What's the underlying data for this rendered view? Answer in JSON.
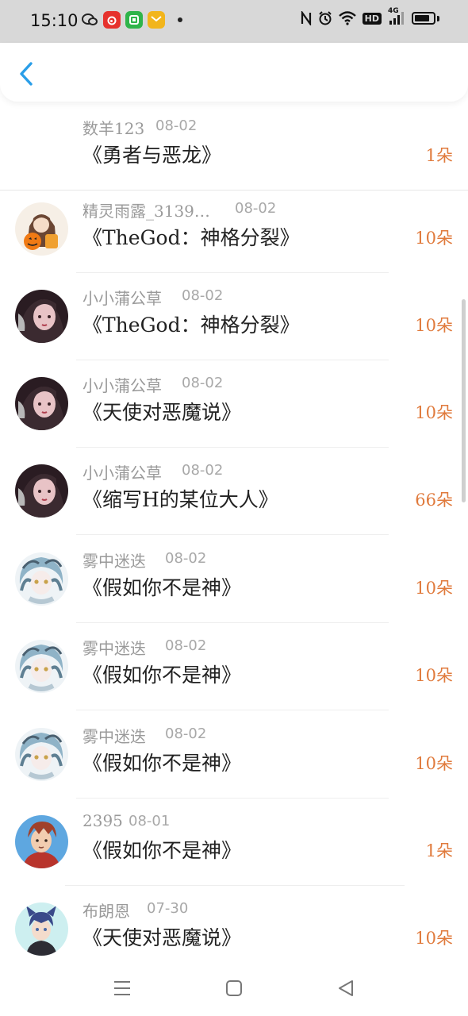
{
  "status_bar": {
    "time": "15:10",
    "left_icons": [
      "wechat-icon",
      "weibo-icon",
      "phone-manager-icon",
      "mail-icon"
    ],
    "right_icons": [
      "nfc-icon",
      "alarm-icon",
      "wifi-icon",
      "hd-icon",
      "signal-4g-icon",
      "battery-icon"
    ],
    "hd_label": "HD",
    "network_label": "4G"
  },
  "header": {
    "back_icon": "chevron-left-icon",
    "accent_color": "#2a9ee8"
  },
  "list": {
    "count_color": "#e07a3c",
    "items": [
      {
        "name": "数羊123",
        "date": "08-02",
        "title": "《勇者与恶龙》",
        "count": "1朵",
        "avatar": "none"
      },
      {
        "name": "精灵雨露_3139…",
        "date": "08-02",
        "title": "《TheGod：神格分裂》",
        "count": "10朵",
        "avatar": "girl-pumpkin"
      },
      {
        "name": "小小蒲公草",
        "date": "08-02",
        "title": "《TheGod：神格分裂》",
        "count": "10朵",
        "avatar": "girl-dark"
      },
      {
        "name": "小小蒲公草",
        "date": "08-02",
        "title": "《天使对恶魔说》",
        "count": "10朵",
        "avatar": "girl-dark"
      },
      {
        "name": "小小蒲公草",
        "date": "08-02",
        "title": "《缩写H的某位大人》",
        "count": "66朵",
        "avatar": "girl-dark"
      },
      {
        "name": "雾中迷迭",
        "date": "08-02",
        "title": "《假如你不是神》",
        "count": "10朵",
        "avatar": "anime-blue"
      },
      {
        "name": "雾中迷迭",
        "date": "08-02",
        "title": "《假如你不是神》",
        "count": "10朵",
        "avatar": "anime-blue"
      },
      {
        "name": "雾中迷迭",
        "date": "08-02",
        "title": "《假如你不是神》",
        "count": "10朵",
        "avatar": "anime-blue"
      },
      {
        "name": "2395",
        "date": "08-01",
        "title": "《假如你不是神》",
        "count": "1朵",
        "avatar": "boy-red"
      },
      {
        "name": "布朗恩",
        "date": "07-30",
        "title": "《天使对恶魔说》",
        "count": "10朵",
        "avatar": "boy-catears"
      }
    ]
  },
  "nav_bar": {
    "icons": [
      "menu-icon",
      "home-square-icon",
      "back-triangle-icon"
    ]
  }
}
